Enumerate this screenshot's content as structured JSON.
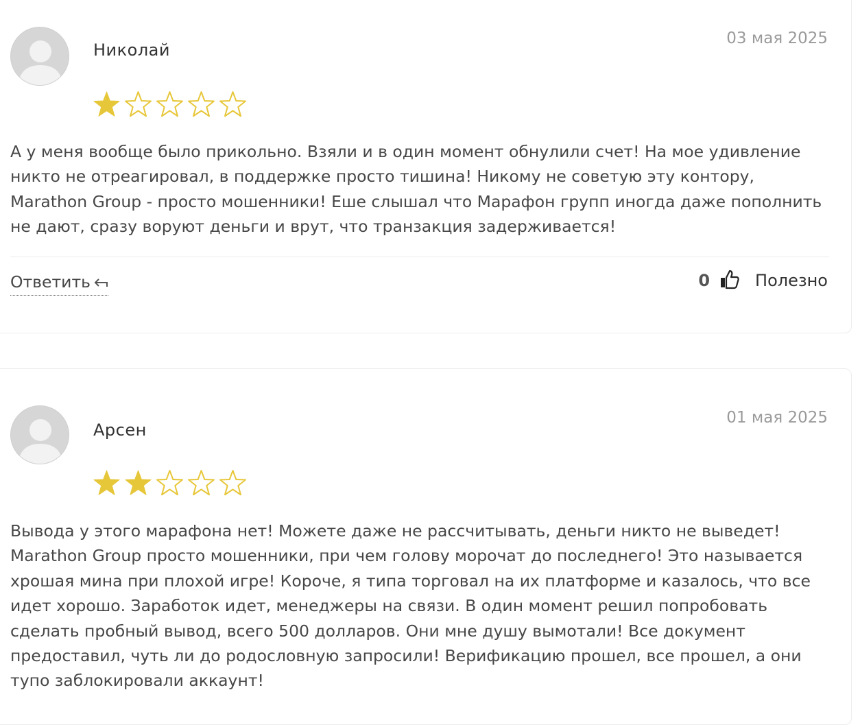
{
  "colors": {
    "star_filled": "#e7c73a",
    "star_outline": "#e7c73a",
    "date_text": "#9a9a9a",
    "body_text": "#474747",
    "avatar_bg": "#d6d6d6",
    "avatar_figure": "#f2f2f2"
  },
  "icons": {
    "avatar": "user-silhouette-icon",
    "star": "star-icon",
    "reply": "reply-arrow-icon",
    "like": "thumbs-up-icon"
  },
  "reviews": [
    {
      "author": "Николай",
      "date": "03 мая 2025",
      "rating": 1,
      "rating_max": 5,
      "text": "А у меня вообще было прикольно. Взяли и в один момент обнулили счет! На мое удивление никто не отреагировал, в поддержке просто тишина! Никому не советую эту контору, Marathon Group - просто мошенники! Еше слышал что Марафон групп иногда даже пополнить не дают, сразу воруют деньги и врут, что транзакция задерживается!",
      "reply_label": "Ответить",
      "likes": "0",
      "useful_label": "Полезно"
    },
    {
      "author": "Арсен",
      "date": "01 мая 2025",
      "rating": 2,
      "rating_max": 5,
      "text": "Вывода у этого марафона нет! Можете даже не рассчитывать, деньги никто не выведет! Marathon Group просто мошенники, при чем голову морочат до последнего! Это называется хрошая мина при плохой игре! Короче, я типа торговал на их платформе и казалось, что все идет хорошо. Заработок идет, менеджеры на связи. В один момент решил попробовать сделать пробный вывод, всего 500 долларов. Они мне душу вымотали! Все документ предоставил, чуть ли до родословную запросили! Верификацию прошел, все прошел, а они тупо заблокировали аккаунт!"
    }
  ]
}
